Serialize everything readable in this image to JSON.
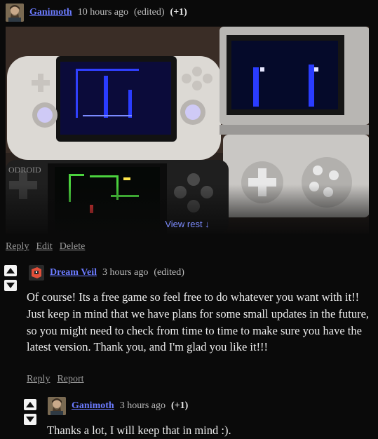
{
  "comment1": {
    "username": "Ganimoth",
    "time": "10 hours ago",
    "edited": "(edited)",
    "score": "(+1)",
    "view_rest": "View rest ↓",
    "device_brand_text": "ODROID",
    "actions": {
      "reply": "Reply",
      "edit": "Edit",
      "delete": "Delete"
    }
  },
  "comment2": {
    "username": "Dream Veil",
    "time": "3 hours ago",
    "edited": "(edited)",
    "body": "Of course! Its a free game so feel free to do whatever you want with it!! Just keep in mind that we have plans for some small updates in the future, so you might need to check from time to time to make sure you have the latest version. Thank you, and I'm glad you like it!!!",
    "actions": {
      "reply": "Reply",
      "report": "Report"
    }
  },
  "comment3": {
    "username": "Ganimoth",
    "time": "3 hours ago",
    "score": "(+1)",
    "body": "Thanks a lot, I will keep that in mind :)."
  },
  "colors": {
    "username": "#6b7bff",
    "background": "#0a0a0a",
    "link_muted": "#9a9a9a",
    "view_rest": "#7d8cff"
  }
}
